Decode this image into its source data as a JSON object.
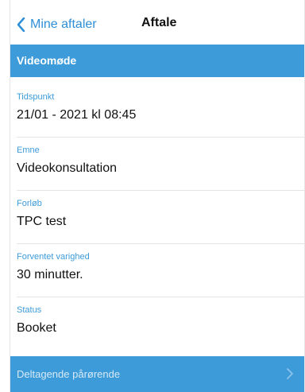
{
  "navbar": {
    "back_label": "Mine aftaler",
    "title": "Aftale"
  },
  "section": {
    "header": "Videomøde"
  },
  "fields": [
    {
      "label": "Tidspunkt",
      "value": "21/01 - 2021 kl 08:45"
    },
    {
      "label": "Emne",
      "value": "Videokonsultation"
    },
    {
      "label": "Forløb",
      "value": "TPC test"
    },
    {
      "label": "Forventet varighed",
      "value": "30 minutter."
    },
    {
      "label": "Status",
      "value": "Booket"
    }
  ],
  "bottom_row": {
    "label": "Deltagende pårørende"
  },
  "colors": {
    "accent": "#3d9bd9",
    "link": "#2f8fd6"
  },
  "icons": {
    "back": "chevron-left-icon",
    "disclosure": "chevron-right-icon"
  }
}
